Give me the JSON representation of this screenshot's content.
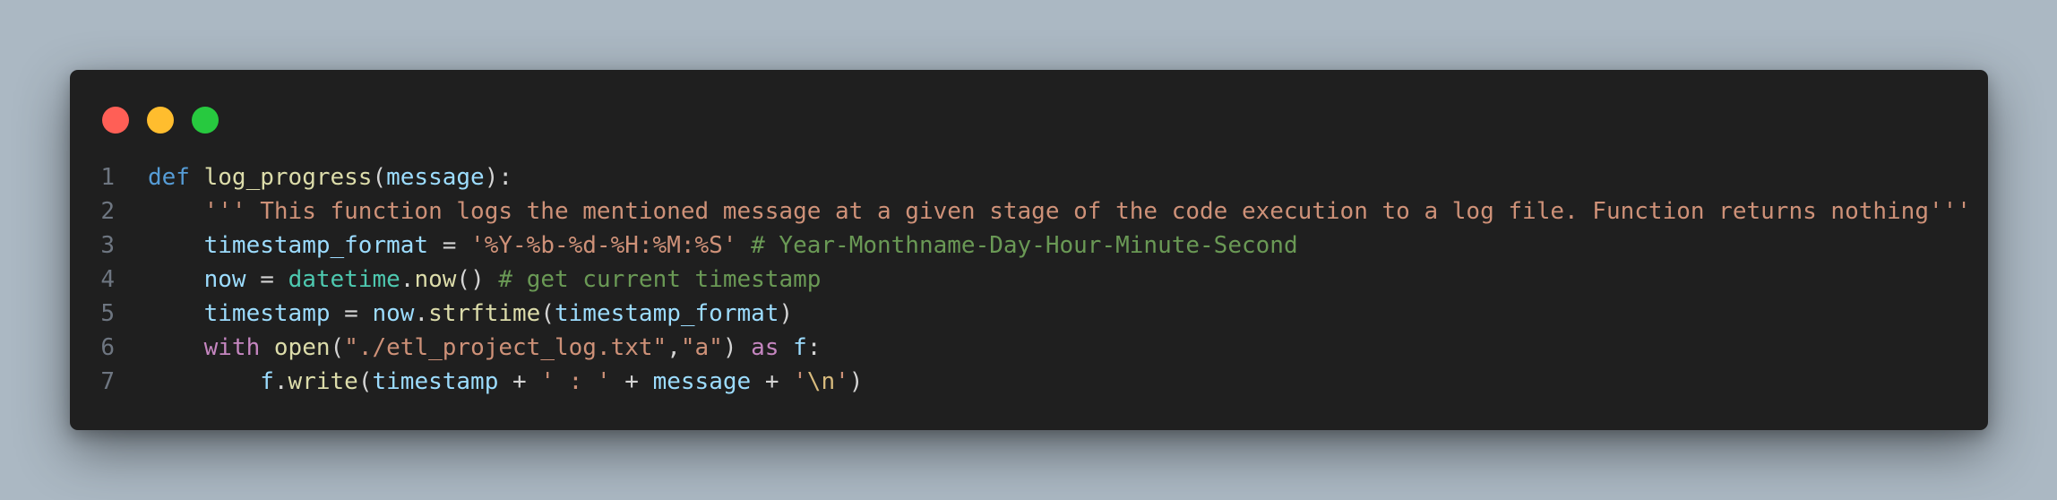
{
  "window": {
    "controls": [
      "close",
      "minimize",
      "maximize"
    ]
  },
  "code": {
    "line_numbers": [
      "1",
      "2",
      "3",
      "4",
      "5",
      "6",
      "7"
    ],
    "lines": [
      [
        {
          "t": "def",
          "k": "kw"
        },
        {
          "t": " ",
          "k": "op"
        },
        {
          "t": "log_progress",
          "k": "fn"
        },
        {
          "t": "(",
          "k": "op"
        },
        {
          "t": "message",
          "k": "var"
        },
        {
          "t": "):",
          "k": "op"
        }
      ],
      [
        {
          "t": "    ",
          "k": "op"
        },
        {
          "t": "''' This function logs the mentioned message at a given stage of the code execution to a log file. Function returns nothing'''",
          "k": "str"
        }
      ],
      [
        {
          "t": "    ",
          "k": "op"
        },
        {
          "t": "timestamp_format",
          "k": "var"
        },
        {
          "t": " = ",
          "k": "op"
        },
        {
          "t": "'%Y-%b-%d-%H:%M:%S'",
          "k": "str"
        },
        {
          "t": " ",
          "k": "op"
        },
        {
          "t": "# Year-Monthname-Day-Hour-Minute-Second",
          "k": "cmt"
        }
      ],
      [
        {
          "t": "    ",
          "k": "op"
        },
        {
          "t": "now",
          "k": "var"
        },
        {
          "t": " = ",
          "k": "op"
        },
        {
          "t": "datetime",
          "k": "cls"
        },
        {
          "t": ".",
          "k": "op"
        },
        {
          "t": "now",
          "k": "fn"
        },
        {
          "t": "() ",
          "k": "op"
        },
        {
          "t": "# get current timestamp",
          "k": "cmt"
        }
      ],
      [
        {
          "t": "    ",
          "k": "op"
        },
        {
          "t": "timestamp",
          "k": "var"
        },
        {
          "t": " = ",
          "k": "op"
        },
        {
          "t": "now",
          "k": "var"
        },
        {
          "t": ".",
          "k": "op"
        },
        {
          "t": "strftime",
          "k": "fn"
        },
        {
          "t": "(",
          "k": "op"
        },
        {
          "t": "timestamp_format",
          "k": "var"
        },
        {
          "t": ")",
          "k": "op"
        }
      ],
      [
        {
          "t": "    ",
          "k": "op"
        },
        {
          "t": "with",
          "k": "ctl"
        },
        {
          "t": " ",
          "k": "op"
        },
        {
          "t": "open",
          "k": "fn"
        },
        {
          "t": "(",
          "k": "op"
        },
        {
          "t": "\"./etl_project_log.txt\"",
          "k": "str"
        },
        {
          "t": ",",
          "k": "op"
        },
        {
          "t": "\"a\"",
          "k": "str"
        },
        {
          "t": ") ",
          "k": "op"
        },
        {
          "t": "as",
          "k": "ctl"
        },
        {
          "t": " ",
          "k": "op"
        },
        {
          "t": "f",
          "k": "var"
        },
        {
          "t": ":",
          "k": "op"
        }
      ],
      [
        {
          "t": "        ",
          "k": "op"
        },
        {
          "t": "f",
          "k": "var"
        },
        {
          "t": ".",
          "k": "op"
        },
        {
          "t": "write",
          "k": "fn"
        },
        {
          "t": "(",
          "k": "op"
        },
        {
          "t": "timestamp",
          "k": "var"
        },
        {
          "t": " + ",
          "k": "op"
        },
        {
          "t": "' : '",
          "k": "str"
        },
        {
          "t": " + ",
          "k": "op"
        },
        {
          "t": "message",
          "k": "var"
        },
        {
          "t": " + ",
          "k": "op"
        },
        {
          "t": "'",
          "k": "str"
        },
        {
          "t": "\\n",
          "k": "esc"
        },
        {
          "t": "'",
          "k": "str"
        },
        {
          "t": ")",
          "k": "op"
        }
      ]
    ]
  },
  "colors": {
    "background": "#abb8c3",
    "window": "#1f1f1f",
    "close": "#ff5f56",
    "minimize": "#ffbd2e",
    "maximize": "#27c93f"
  }
}
